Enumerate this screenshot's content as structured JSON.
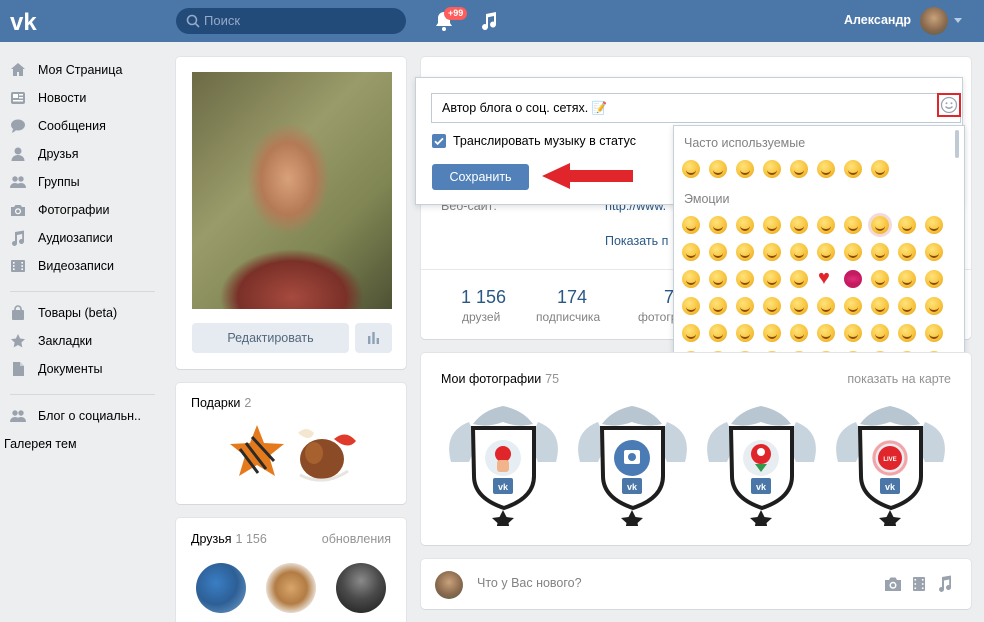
{
  "header": {
    "search_placeholder": "Поиск",
    "notifications_badge": "+99",
    "user_name": "Александр",
    "brand_color": "#4a76a8"
  },
  "sidebar": {
    "items": [
      {
        "label": "Моя Страница",
        "icon": "home-icon"
      },
      {
        "label": "Новости",
        "icon": "news-icon"
      },
      {
        "label": "Сообщения",
        "icon": "messages-icon"
      },
      {
        "label": "Друзья",
        "icon": "friend-icon"
      },
      {
        "label": "Группы",
        "icon": "groups-icon"
      },
      {
        "label": "Фотографии",
        "icon": "camera-icon"
      },
      {
        "label": "Аудиозаписи",
        "icon": "music-icon"
      },
      {
        "label": "Видеозаписи",
        "icon": "video-icon"
      }
    ],
    "items2": [
      {
        "label": "Товары (beta)",
        "icon": "bag-icon"
      },
      {
        "label": "Закладки",
        "icon": "star-icon"
      },
      {
        "label": "Документы",
        "icon": "document-icon"
      }
    ],
    "items3": [
      {
        "label": "Блог о социальн..",
        "icon": "groups-icon"
      }
    ],
    "gallery": "Галерея тем"
  },
  "profile": {
    "edit_button": "Редактировать"
  },
  "gifts": {
    "title": "Подарки",
    "count": "2"
  },
  "friends": {
    "title": "Друзья",
    "count": "1 156",
    "updates_link": "обновления"
  },
  "info": {
    "website_label": "Веб-сайт:",
    "website_value": "http://www.",
    "show_more": "Показать п"
  },
  "counters": [
    {
      "num": "1 156",
      "label": "друзей"
    },
    {
      "num": "174",
      "label": "подписчика"
    },
    {
      "num": "7",
      "label": "фотогр"
    }
  ],
  "status": {
    "value": "Автор блога о соц. сетях. 📝",
    "checkbox_label": "Транслировать музыку в статус",
    "checkbox_checked": true,
    "save_button": "Сохранить"
  },
  "emoji_panel": {
    "frequent_title": "Часто используемые",
    "emotions_title": "Эмоции"
  },
  "photos": {
    "title": "Мои фотографии",
    "count": "75",
    "map_link": "показать на карте",
    "live_label": "LIVE"
  },
  "post": {
    "placeholder": "Что у Вас нового?"
  }
}
